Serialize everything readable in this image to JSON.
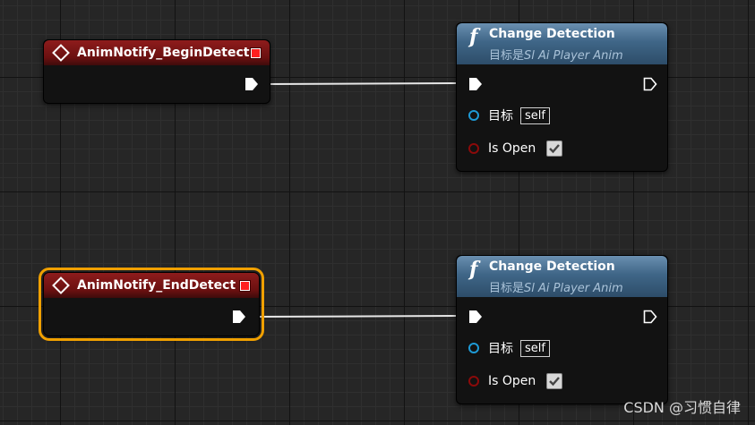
{
  "event_nodes": [
    {
      "title": "AnimNotify_BeginDetect",
      "selected": false
    },
    {
      "title": "AnimNotify_EndDetect",
      "selected": true
    }
  ],
  "function_nodes": [
    {
      "title": "Change Detection",
      "subtitle_prefix": "目标是",
      "subtitle_target": "Sl Ai Player Anim",
      "target_pin_label": "目标",
      "target_value": "self",
      "bool_pin_label": "Is Open",
      "bool_value": true
    },
    {
      "title": "Change Detection",
      "subtitle_prefix": "目标是",
      "subtitle_target": "Sl Ai Player Anim",
      "target_pin_label": "目标",
      "target_value": "self",
      "bool_pin_label": "Is Open",
      "bool_value": true
    }
  ],
  "colors": {
    "event_header": "#8e1c1c",
    "function_header": "#3f6687",
    "selection_outline": "#f0a000",
    "object_pin": "#1e9ad6",
    "bool_pin": "#8b0a0a"
  },
  "watermark": "CSDN @习惯自律"
}
